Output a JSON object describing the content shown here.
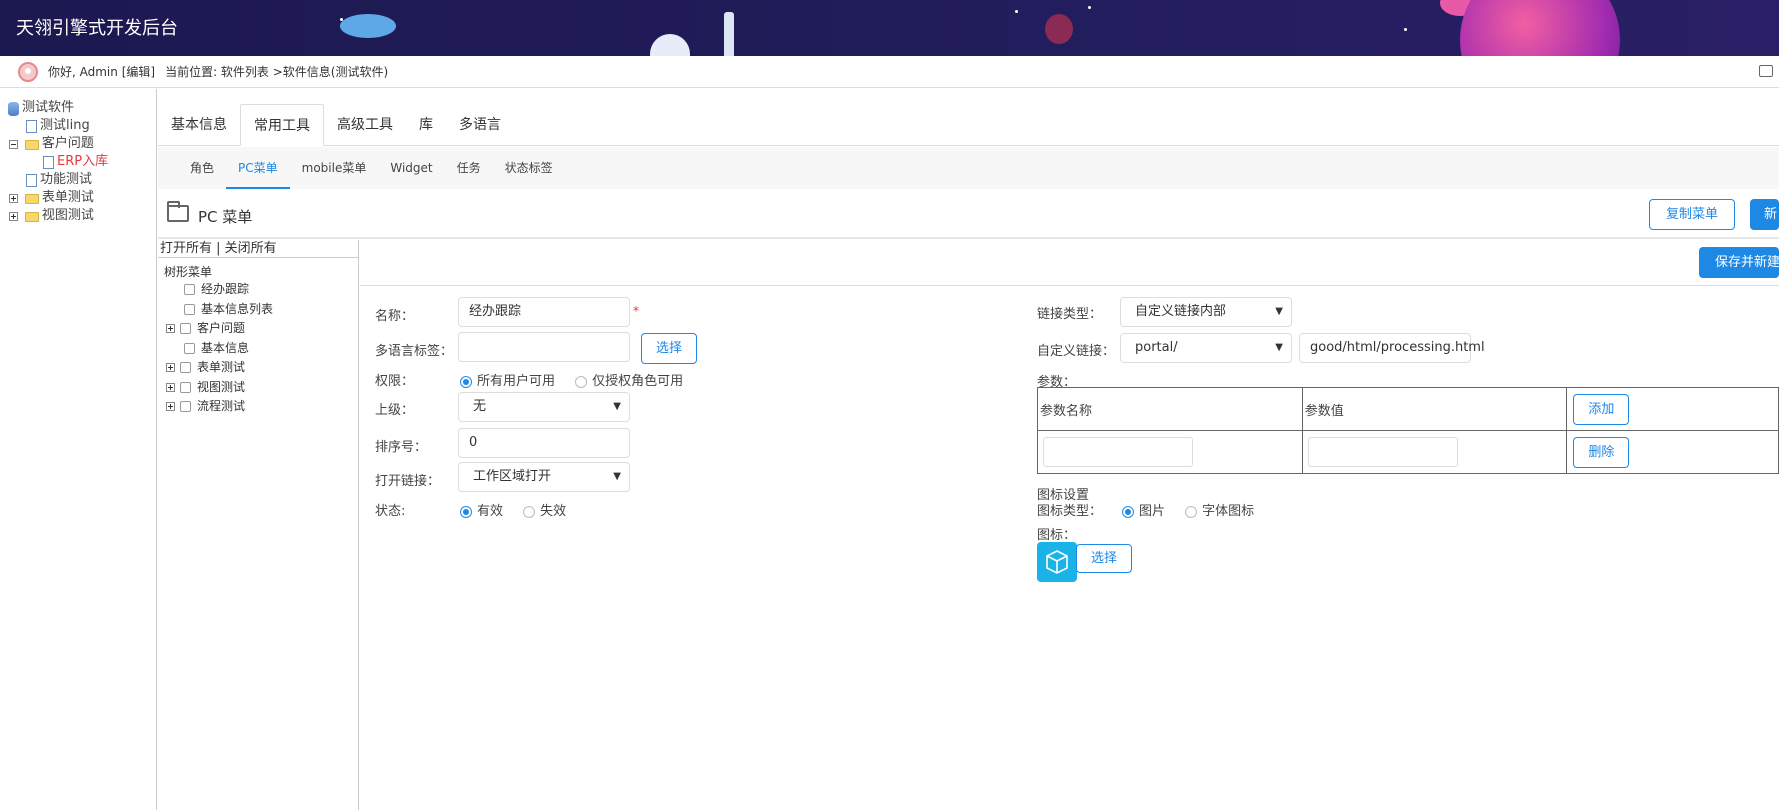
{
  "app": {
    "title": "天翎引擎式开发后台"
  },
  "topbar": {
    "greeting": "你好, Admin [编辑]",
    "breadcrumb": "当前位置: 软件列表 >软件信息(测试软件)"
  },
  "left_tree": {
    "items": [
      {
        "label": "测试软件"
      },
      {
        "label": "测试ling"
      },
      {
        "label": "客户问题"
      },
      {
        "label": "ERP入库"
      },
      {
        "label": "功能测试"
      },
      {
        "label": "表单测试"
      },
      {
        "label": "视图测试"
      }
    ]
  },
  "tabs": [
    "基本信息",
    "常用工具",
    "高级工具",
    "库",
    "多语言"
  ],
  "subtabs": [
    "角色",
    "PC菜单",
    "mobile菜单",
    "Widget",
    "任务",
    "状态标签"
  ],
  "section": {
    "title": "PC 菜单",
    "copy_label": "复制菜单",
    "new_label": "新",
    "save_label": "保存并新建"
  },
  "menu_tree": {
    "open_all": "打开所有",
    "separator": " | ",
    "close_all": "关闭所有",
    "root": "树形菜单",
    "items": [
      "经办跟踪",
      "基本信息列表",
      "客户问题",
      "基本信息",
      "表单测试",
      "视图测试",
      "流程测试"
    ]
  },
  "form": {
    "name_label": "名称：",
    "name_value": "经办跟踪",
    "required_mark": "*",
    "i18n_label": "多语言标签：",
    "i18n_value": "",
    "choose_label": "选择",
    "perm_label": "权限：",
    "perm_options": [
      "所有用户可用",
      "仅授权角色可用"
    ],
    "parent_label": "上级：",
    "parent_value": "无",
    "order_label": "排序号：",
    "order_value": "0",
    "open_label": "打开链接：",
    "open_value": "工作区域打开",
    "status_label": "状态:",
    "status_options": [
      "有效",
      "失效"
    ],
    "link_type_label": "链接类型：",
    "link_type_value": "自定义链接内部",
    "custom_link_label": "自定义链接：",
    "custom_link_prefix": "portal/",
    "custom_link_value": "good/html/processing.html",
    "params_label": "参数：",
    "param_name_header": "参数名称",
    "param_value_header": "参数值",
    "add_label": "添加",
    "delete_label": "删除",
    "icon_settings_label": "图标设置",
    "icon_type_label": "图标类型：",
    "icon_type_options": [
      "图片",
      "字体图标"
    ],
    "icon_label": "图标：",
    "icon_choose_label": "选择"
  },
  "colors": {
    "accent": "#1e88e5",
    "header_bg": "#1c1850",
    "icon_bg": "#1ab3e8",
    "active_tree": "#e4393c"
  }
}
